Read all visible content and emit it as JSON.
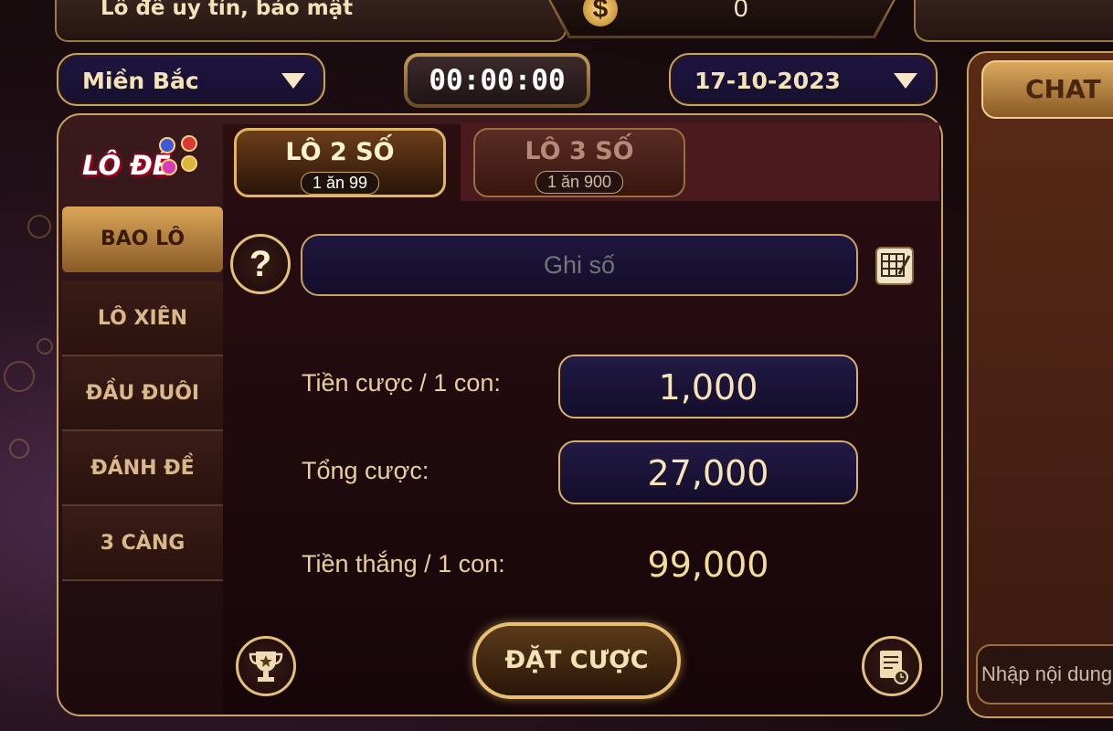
{
  "header": {
    "banner_text": "Lô đề uy tín, bảo mật",
    "balance": "0"
  },
  "controls": {
    "region": "Miền Bắc",
    "timer": "00:00:00",
    "date": "17-10-2023"
  },
  "logo": {
    "text": "LÔ ĐỀ"
  },
  "side_menu": [
    {
      "label": "BAO LÔ",
      "active": true
    },
    {
      "label": "LÔ XIÊN",
      "active": false
    },
    {
      "label": "ĐẦU ĐUÔI",
      "active": false
    },
    {
      "label": "ĐÁNH ĐỀ",
      "active": false
    },
    {
      "label": "3 CÀNG",
      "active": false
    }
  ],
  "tabs": [
    {
      "label": "LÔ 2 SỐ",
      "sub": "1 ăn 99",
      "active": true
    },
    {
      "label": "LÔ 3 SỐ",
      "sub": "1 ăn 900",
      "active": false
    }
  ],
  "bet_form": {
    "number_placeholder": "Ghi số",
    "stake_label": "Tiền cược / 1 con:",
    "stake_value": "1,000",
    "total_label": "Tổng cược:",
    "total_value": "27,000",
    "win_label": "Tiền thắng / 1 con:",
    "win_value": "99,000",
    "submit_label": "ĐẶT CƯỢC"
  },
  "chat": {
    "title": "CHAT",
    "input_placeholder": "Nhập nội dung"
  },
  "icons": {
    "help": "question-icon",
    "numbers": "number-grid-icon",
    "trophy": "trophy-icon",
    "history": "history-icon",
    "currency": "dollar-icon",
    "dropdown": "chevron-down-icon"
  },
  "colors": {
    "gold": "#c9a265",
    "panel_navy": "#1e1540",
    "active_tab_border": "#e2b463"
  }
}
